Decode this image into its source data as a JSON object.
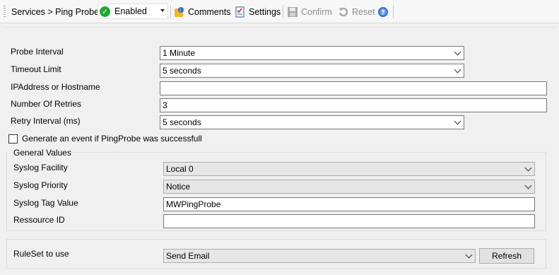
{
  "toolbar": {
    "breadcrumb": "Services > Ping Probe",
    "status": "Enabled",
    "comments": "Comments",
    "settings": "Settings",
    "confirm": "Confirm",
    "reset": "Reset"
  },
  "form": {
    "probe_interval": {
      "label": "Probe Interval",
      "value": "1 Minute"
    },
    "timeout_limit": {
      "label": "Timeout Limit",
      "value": "5 seconds"
    },
    "ip_address": {
      "label": "IPAddress or Hostname",
      "value": ""
    },
    "retries": {
      "label": "Number Of Retries",
      "value": "3"
    },
    "retry_interval": {
      "label": "Retry Interval (ms)",
      "value": "5 seconds"
    },
    "generate_event": {
      "label": "Generate an event if PingProbe was successfull",
      "checked": false
    }
  },
  "general": {
    "title": "General Values",
    "facility": {
      "label": "Syslog Facility",
      "value": "Local 0"
    },
    "priority": {
      "label": "Syslog Priority",
      "value": "Notice"
    },
    "tag": {
      "label": "Syslog Tag Value",
      "value": "MWPingProbe"
    },
    "resource": {
      "label": "Ressource ID",
      "value": ""
    }
  },
  "ruleset": {
    "label": "RuleSet to use",
    "value": "Send Email",
    "refresh": "Refresh"
  },
  "colors": {
    "enabled_green": "#1fa832",
    "help_blue": "#2f6fd6",
    "comment_yellow": "#f3b81e"
  }
}
